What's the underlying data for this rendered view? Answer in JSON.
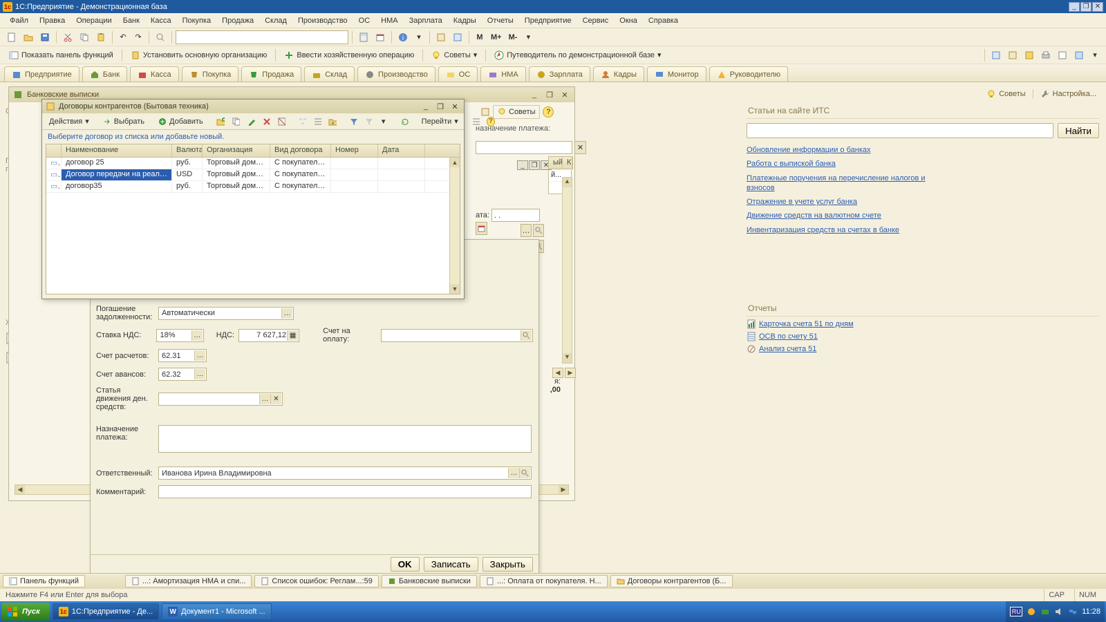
{
  "titlebar": {
    "title": "1С:Предприятие - Демонстрационная база"
  },
  "menu": [
    "Файл",
    "Правка",
    "Операции",
    "Банк",
    "Касса",
    "Покупка",
    "Продажа",
    "Склад",
    "Производство",
    "ОС",
    "НМА",
    "Зарплата",
    "Кадры",
    "Отчеты",
    "Предприятие",
    "Сервис",
    "Окна",
    "Справка"
  ],
  "toolbar2": {
    "showFnPanel": "Показать панель функций",
    "setOrg": "Установить основную организацию",
    "enterOp": "Ввести хозяйственную операцию",
    "tips": "Советы",
    "guide": "Путеводитель по демонстрационной базе"
  },
  "navTabs": [
    "Предприятие",
    "Банк",
    "Касса",
    "Покупка",
    "Продажа",
    "Склад",
    "Производство",
    "ОС",
    "НМА",
    "Зарплата",
    "Кадры",
    "Монитор",
    "Руководителю"
  ],
  "bankPanel": {
    "title": "Банковские выписки"
  },
  "contractsDialog": {
    "title": "Договоры контрагентов (Бытовая техника)",
    "actions": "Действия",
    "choose": "Выбрать",
    "add": "Добавить",
    "goto": "Перейти",
    "hint": "Выберите договор из списка или добавьте новый.",
    "cols": {
      "name": "Наименование",
      "cur": "Валюта",
      "org": "Организация",
      "type": "Вид договора",
      "num": "Номер",
      "date": "Дата"
    },
    "rows": [
      {
        "name": "договор 25",
        "cur": "руб.",
        "org": "Торговый дом \"Ко...",
        "type": "С покупателем",
        "num": "",
        "date": ""
      },
      {
        "name": "Договор передачи на реализац...",
        "cur": "USD",
        "org": "Торговый дом \"Ко...",
        "type": "С покупателем",
        "num": "",
        "date": ""
      },
      {
        "name": "договор35",
        "cur": "руб.",
        "org": "Торговый дом \"Ко...",
        "type": "С покупателем",
        "num": "",
        "date": ""
      }
    ],
    "selectedRow": 1
  },
  "sideTips": {
    "label": "Советы"
  },
  "peekLabels": {
    "назначение": "назначение платежа:",
    "date": "ата:",
    "dateMask": ". .",
    "listHeaders": [
      "ый",
      "К"
    ],
    "listRows": [
      "й...",
      ""
    ]
  },
  "docForm": {
    "погашение_label": "Погашение задолженности:",
    "погашение_value": "Автоматически",
    "ставкаНДС_label": "Ставка НДС:",
    "ставкаНДС_value": "18%",
    "ндс_label": "НДС:",
    "ндс_value": "7 627,12",
    "счетОплату_label": "Счет на оплату:",
    "счетРасчетов_label": "Счет расчетов:",
    "счетРасчетов_value": "62.31",
    "счетАвансов_label": "Счет авансов:",
    "счетАвансов_value": "62.32",
    "статья_label": "Статья движения ден. средств:",
    "назначение_label": "Назначение платежа:",
    "ответственный_label": "Ответственный:",
    "ответственный_value": "Иванова Ирина Владимировна",
    "комментарий_label": "Комментарий:",
    "ok": "OK",
    "save": "Записать",
    "close": "Закрыть"
  },
  "statusSum": {
    "label": "я:",
    "value": ",00"
  },
  "rightSide": {
    "tips": "Советы",
    "settings": "Настройка...",
    "heading": "Статьи на сайте ИТС",
    "search": "Найти",
    "links": [
      "Обновление информации о банках",
      "Работа с выпиской банка",
      "Платежные поручения на перечисление налогов и взносов",
      "Отражение в учете услуг банка",
      "Движение средств на валютном счете",
      "Инвентаризация средств на счетах в банке"
    ]
  },
  "reports": {
    "heading": "Отчеты",
    "items": [
      "Карточка счета 51 по дням",
      "ОСВ по счету 51",
      "Анализ счета 51"
    ]
  },
  "appBottom": {
    "fnPanel": "Панель функций",
    "tabs": [
      "...: Амортизация НМА и спи...",
      "Список ошибок: Реглам...:59",
      "Банковские выписки",
      "...: Оплата от покупателя. Н...",
      "Договоры контрагентов (Б..."
    ],
    "status": "Нажмите F4 или Enter для выбора",
    "cap": "CAP",
    "num": "NUM",
    "ru": "RU"
  },
  "taskbar": {
    "start": "Пуск",
    "apps": [
      "1С:Предприятие - Де...",
      "Документ1 - Microsoft ..."
    ],
    "lang": "RU",
    "clock": "11:28"
  },
  "mButtons": [
    "M",
    "M+",
    "M-"
  ]
}
